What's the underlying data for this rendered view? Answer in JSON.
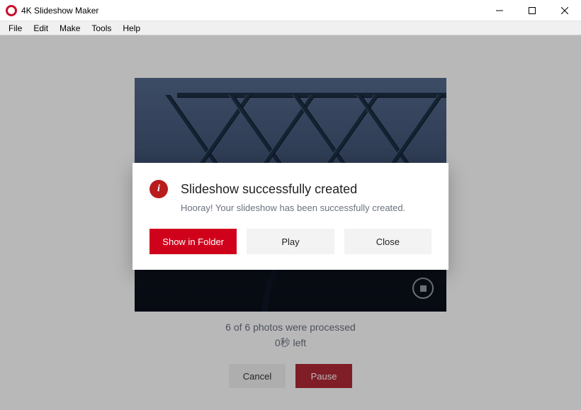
{
  "titlebar": {
    "title": "4K Slideshow Maker"
  },
  "menu": {
    "items": [
      "File",
      "Edit",
      "Make",
      "Tools",
      "Help"
    ]
  },
  "status": {
    "line": "6 of 6 photos were processed",
    "time_left": "0秒 left"
  },
  "footer": {
    "cancel": "Cancel",
    "pause": "Pause"
  },
  "preview_controls": {
    "stop_icon": "stop"
  },
  "modal": {
    "info_glyph": "i",
    "title": "Slideshow successfully created",
    "subtitle": "Hooray! Your slideshow has been successfully created.",
    "buttons": {
      "primary": "Show in Folder",
      "play": "Play",
      "close": "Close"
    }
  },
  "colors": {
    "brand_red": "#d0021b",
    "dark_red": "#b02a37",
    "muted_text": "#6b7280"
  }
}
